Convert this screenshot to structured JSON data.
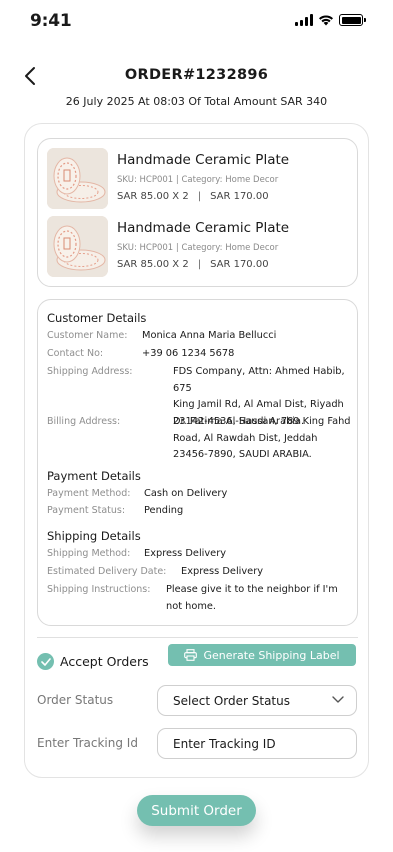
{
  "status_bar": {
    "time": "9:41"
  },
  "header": {
    "title": "ORDER#1232896",
    "subtitle": "26 July 2025 At 08:03 Of Total Amount SAR 340"
  },
  "products": [
    {
      "name": "Handmade Ceramic Plate",
      "meta": "SKU: HCP001 | Category: Home Decor",
      "qty_price": "SAR 85.00 X 2",
      "separator": "|",
      "total": "SAR 170.00"
    },
    {
      "name": "Handmade Ceramic Plate",
      "meta": "SKU: HCP001 | Category: Home Decor",
      "qty_price": "SAR 85.00 X 2",
      "separator": "|",
      "total": "SAR 170.00"
    }
  ],
  "customer": {
    "title": "Customer Details",
    "name_label": "Customer Name:",
    "name": "Monica Anna Maria Bellucci",
    "contact_label": "Contact No:",
    "contact": "+39 06 1234 5678",
    "shipping_label": "Shipping Address:",
    "shipping_lines": [
      "FDS Company, Attn: Ahmed Habib, 675",
      "King Jamil Rd, Al Amal Dist, Riyadh",
      "23142-4536, Saudi Arabia."
    ],
    "billing_label": "Billing Address:",
    "billing_lines": [
      "Dr. Fatima Al-Hassan, 789 King Fahd",
      "Road, Al Rawdah Dist, Jeddah",
      "23456-7890, SAUDI ARABIA."
    ]
  },
  "payment": {
    "title": "Payment Details",
    "method_label": "Payment Method:",
    "method": "Cash on Delivery",
    "status_label": "Payment Status:",
    "status": "Pending"
  },
  "shipping": {
    "title": "Shipping Details",
    "method_label": "Shipping Method:",
    "method": "Express Delivery",
    "eta_label": "Estimated Delivery Date:",
    "eta": "Express Delivery",
    "instructions_label": "Shipping Instructions:",
    "instructions_lines": [
      "Please give it to the neighbor if I'm",
      "not home."
    ]
  },
  "actions": {
    "accept_label": "Accept Orders",
    "accept_checked": true,
    "generate_label": "Generate Shipping Label",
    "order_status_label": "Order Status",
    "order_status_value": "Select Order Status",
    "tracking_label": "Enter Tracking Id",
    "tracking_placeholder": "Enter Tracking ID",
    "submit_label": "Submit Order"
  },
  "colors": {
    "accent": "#74bfb0",
    "border": "#d9d9d9",
    "muted_text": "#8e8e8e"
  },
  "icons": [
    "back-arrow-icon",
    "signal-icon",
    "wifi-icon",
    "battery-icon",
    "check-icon",
    "printer-icon",
    "chevron-down-icon"
  ]
}
